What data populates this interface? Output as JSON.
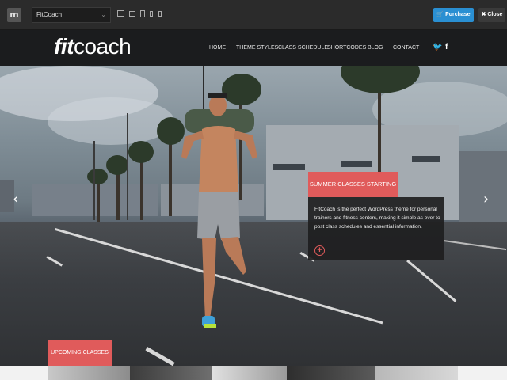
{
  "toolbar": {
    "logo_letter": "m",
    "theme_select": "FitCoach",
    "purchase_label": "Purchase",
    "close_label": "Close"
  },
  "site": {
    "logo_bold": "fit",
    "logo_light": "coach",
    "nav": [
      "HOME",
      "THEME STYLES",
      "CLASS SCHEDULE",
      "SHORTCODES",
      "BLOG",
      "CONTACT"
    ],
    "social": [
      "twitter-icon",
      "facebook-icon"
    ]
  },
  "hero": {
    "callout_title": "SUMMER CLASSES STARTING",
    "callout_text": "FitCoach is the perfect WordPress theme for personal trainers and fitness centers, making it simple as ever to post class schedules and essential information.",
    "prev_arrow": "‹",
    "next_arrow": "›"
  },
  "upcoming_label": "UPCOMING CLASSES",
  "colors": {
    "accent": "#e05b5b",
    "purchase": "#2a8fd2",
    "header_bg": "#1b1c1e"
  }
}
